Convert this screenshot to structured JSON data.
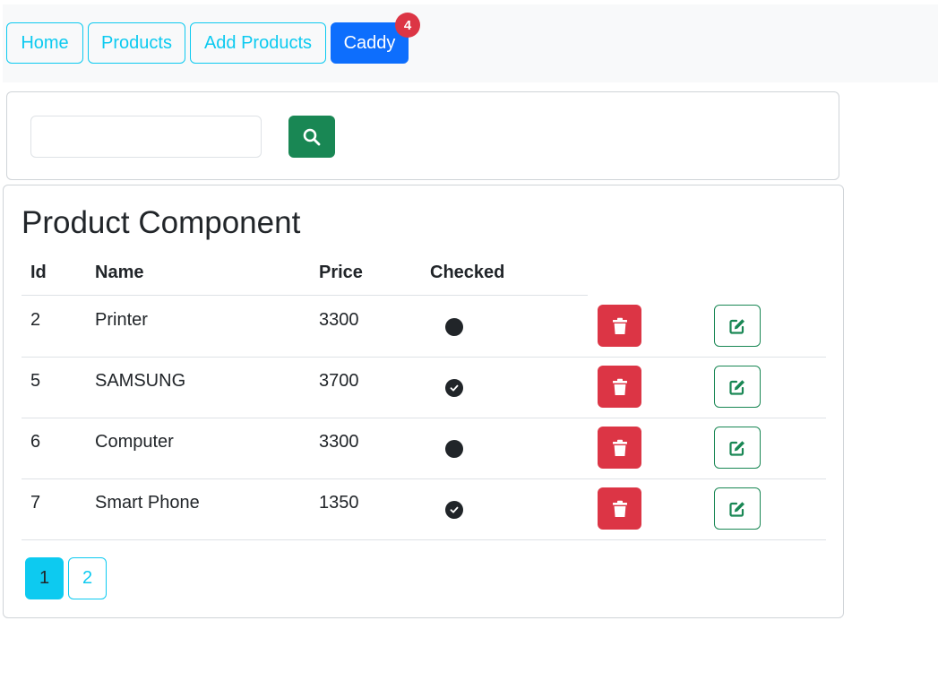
{
  "nav": {
    "home": "Home",
    "products": "Products",
    "add_products": "Add Products",
    "caddy": "Caddy",
    "caddy_count": "4"
  },
  "search": {
    "value": "",
    "placeholder": "",
    "icon": "search-icon"
  },
  "products": {
    "title": "Product Component",
    "columns": {
      "id": "Id",
      "name": "Name",
      "price": "Price",
      "checked": "Checked"
    },
    "rows": [
      {
        "id": "2",
        "name": "Printer",
        "price": "3300",
        "checked": false
      },
      {
        "id": "5",
        "name": "SAMSUNG",
        "price": "3700",
        "checked": true
      },
      {
        "id": "6",
        "name": "Computer",
        "price": "3300",
        "checked": false
      },
      {
        "id": "7",
        "name": "Smart Phone",
        "price": "1350",
        "checked": true
      }
    ]
  },
  "pagination": {
    "pages": [
      "1",
      "2"
    ],
    "current": "1"
  },
  "colors": {
    "info": "#0dcaf0",
    "primary": "#0d6efd",
    "danger": "#dc3545",
    "success": "#198754"
  }
}
